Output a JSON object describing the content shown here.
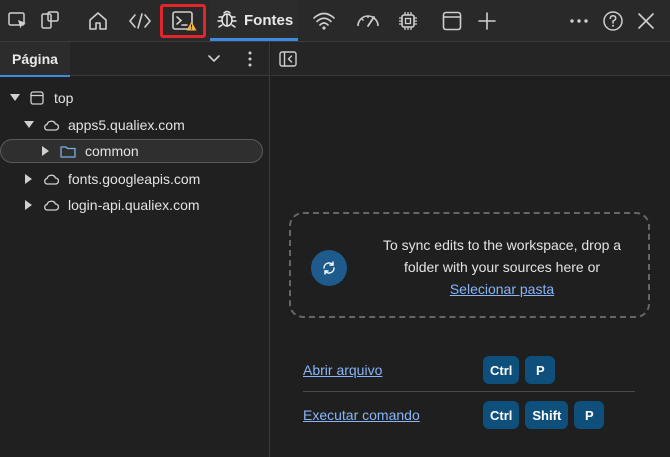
{
  "toolbar": {
    "sources_tab_label": "Fontes",
    "icons": [
      "inspect-element-icon",
      "device-emulation-icon",
      "home-icon",
      "elements-icon",
      "console-icon",
      "warning-badge-icon",
      "bug-icon",
      "network-icon",
      "performance-icon",
      "memory-icon",
      "application-icon",
      "add-tool-icon",
      "more-icon",
      "help-icon",
      "close-icon"
    ],
    "highlight_color": "#e0262b",
    "accent_color": "#3c8be0"
  },
  "left_panel": {
    "tab_label": "Página",
    "tree": [
      {
        "label": "top",
        "icon": "frame-icon",
        "expanded": true
      },
      {
        "label": "apps5.qualiex.com",
        "icon": "cloud-icon",
        "expanded": true
      },
      {
        "label": "common",
        "icon": "folder-icon",
        "expanded": false,
        "selected": true
      },
      {
        "label": "fonts.googleapis.com",
        "icon": "cloud-icon",
        "expanded": false
      },
      {
        "label": "login-api.qualiex.com",
        "icon": "cloud-icon",
        "expanded": false
      }
    ]
  },
  "workspace": {
    "drop_text": "To sync edits to the workspace, drop a folder with your sources here or",
    "select_folder_link": "Selecionar pasta"
  },
  "shortcuts": [
    {
      "label": "Abrir arquivo",
      "keys": [
        "Ctrl",
        "P"
      ]
    },
    {
      "label": "Executar comando",
      "keys": [
        "Ctrl",
        "Shift",
        "P"
      ]
    }
  ]
}
